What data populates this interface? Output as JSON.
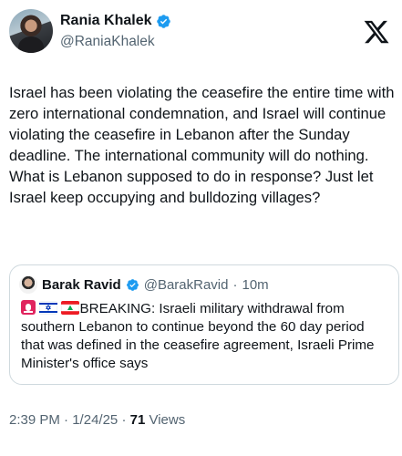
{
  "author": {
    "display_name": "Rania Khalek",
    "handle": "@RaniaKhalek"
  },
  "tweet": {
    "text": "Israel has been violating the ceasefire the entire time with zero international condemnation, and Israel will continue violating the ceasefire in Lebanon after the Sunday deadline. The international community will do nothing. What is Lebanon supposed to do in response? Just let Israel keep occupying and bulldozing villages?"
  },
  "quoted": {
    "display_name": "Barak Ravid",
    "handle": "@BarakRavid",
    "time_ago": "10m",
    "text": "BREAKING: Israeli military withdrawal from southern Lebanon to continue beyond the 60 day period that was defined in the ceasefire agreement, Israeli Prime Minister's office says"
  },
  "meta": {
    "time": "2:39 PM",
    "date": "1/24/25",
    "views_count": "71",
    "views_label": "Views"
  },
  "icons": {
    "verified": "verified-badge-icon",
    "logo": "x-logo-icon",
    "siren": "siren-icon",
    "flag_il": "israel-flag-icon",
    "flag_lb": "lebanon-flag-icon"
  },
  "colors": {
    "verified": "#1d9bf0",
    "text": "#0f1419",
    "muted": "#536471",
    "border": "#cfd9de"
  }
}
